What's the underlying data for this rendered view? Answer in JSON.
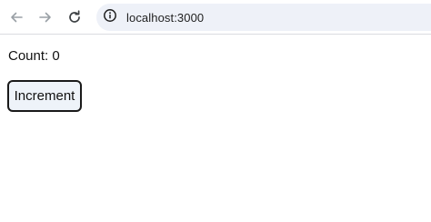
{
  "browser": {
    "address_bar": {
      "url": "localhost:3000"
    },
    "icons": {
      "back": "back-arrow-icon",
      "forward": "forward-arrow-icon",
      "reload": "reload-icon",
      "site_info": "info-icon"
    }
  },
  "page": {
    "count_text": "Count: 0",
    "increment_label": "Increment"
  },
  "colors": {
    "toolbar_bg": "#ffffff",
    "omnibox_bg": "#eef1f8",
    "button_bg": "#eef3f9",
    "button_border": "#1a1a1a",
    "nav_icon_disabled": "#9aa0a6",
    "nav_icon_enabled": "#3c4043"
  }
}
